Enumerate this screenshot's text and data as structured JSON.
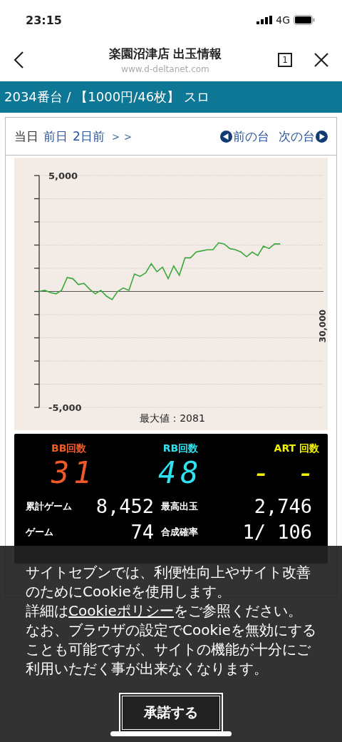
{
  "status_bar": {
    "time": "23:15",
    "network": "4G"
  },
  "browser": {
    "title": "楽園沼津店 出玉情報",
    "url": "www.d-deltanet.com",
    "tab_count": "1"
  },
  "banner": "2034番台 / 【1000円/46枚】 スロ",
  "day_nav": {
    "days": [
      {
        "label": "当日",
        "selected": true
      },
      {
        "label": "前日",
        "selected": false
      },
      {
        "label": "2日前",
        "selected": false
      }
    ],
    "more": "＞＞",
    "prev": "前の台",
    "next": "次の台"
  },
  "chart": {
    "chart_data": {
      "type": "line",
      "ylim": [
        -5000,
        5000
      ],
      "yticks": [
        {
          "value": 5000,
          "label": "5,000"
        },
        {
          "value": -5000,
          "label": "-5,000"
        }
      ],
      "annotations": [
        {
          "text": "30,000"
        }
      ],
      "series": [
        {
          "color": "#3aa83a",
          "values": [
            0,
            50,
            -50,
            -100,
            50,
            600,
            550,
            300,
            350,
            100,
            -100,
            50,
            -200,
            -350,
            0,
            150,
            50,
            750,
            650,
            800,
            1200,
            850,
            1050,
            550,
            1100,
            700,
            1450,
            1450,
            1700,
            1750,
            1800,
            1800,
            2100,
            2050,
            1850,
            1800,
            1700,
            1500,
            1700,
            1550,
            1950,
            1850,
            2050,
            2050
          ]
        }
      ]
    },
    "caption": "最大値：2081"
  },
  "stats": {
    "counters": [
      {
        "label": "BB回数",
        "value": "31",
        "color": "#f05a28"
      },
      {
        "label": "RB回数",
        "value": "48",
        "color": "#2ee3ef"
      },
      {
        "label": "ART 回数",
        "value": "- -",
        "color": "#f2f200"
      }
    ],
    "rows": [
      {
        "label": "累計ゲーム",
        "value": "8,452"
      },
      {
        "label": "最高出玉",
        "value": "2,746"
      },
      {
        "label": "ゲーム",
        "value": "74"
      },
      {
        "label": "合成確率",
        "value": "1/ 106"
      }
    ]
  },
  "cookie": {
    "text_1": "サイトセブンでは、利便性向上やサイト改善のためにCookieを使用します。",
    "before_link": "詳細は",
    "link": "Cookieポリシー",
    "after_link": "をご参照ください。",
    "text_2": "なお、ブラウザの設定でCookieを無効にすることも可能ですが、サイトの機能が十分にご利用いただく事が出来なくなります。",
    "button": "承諾する"
  }
}
